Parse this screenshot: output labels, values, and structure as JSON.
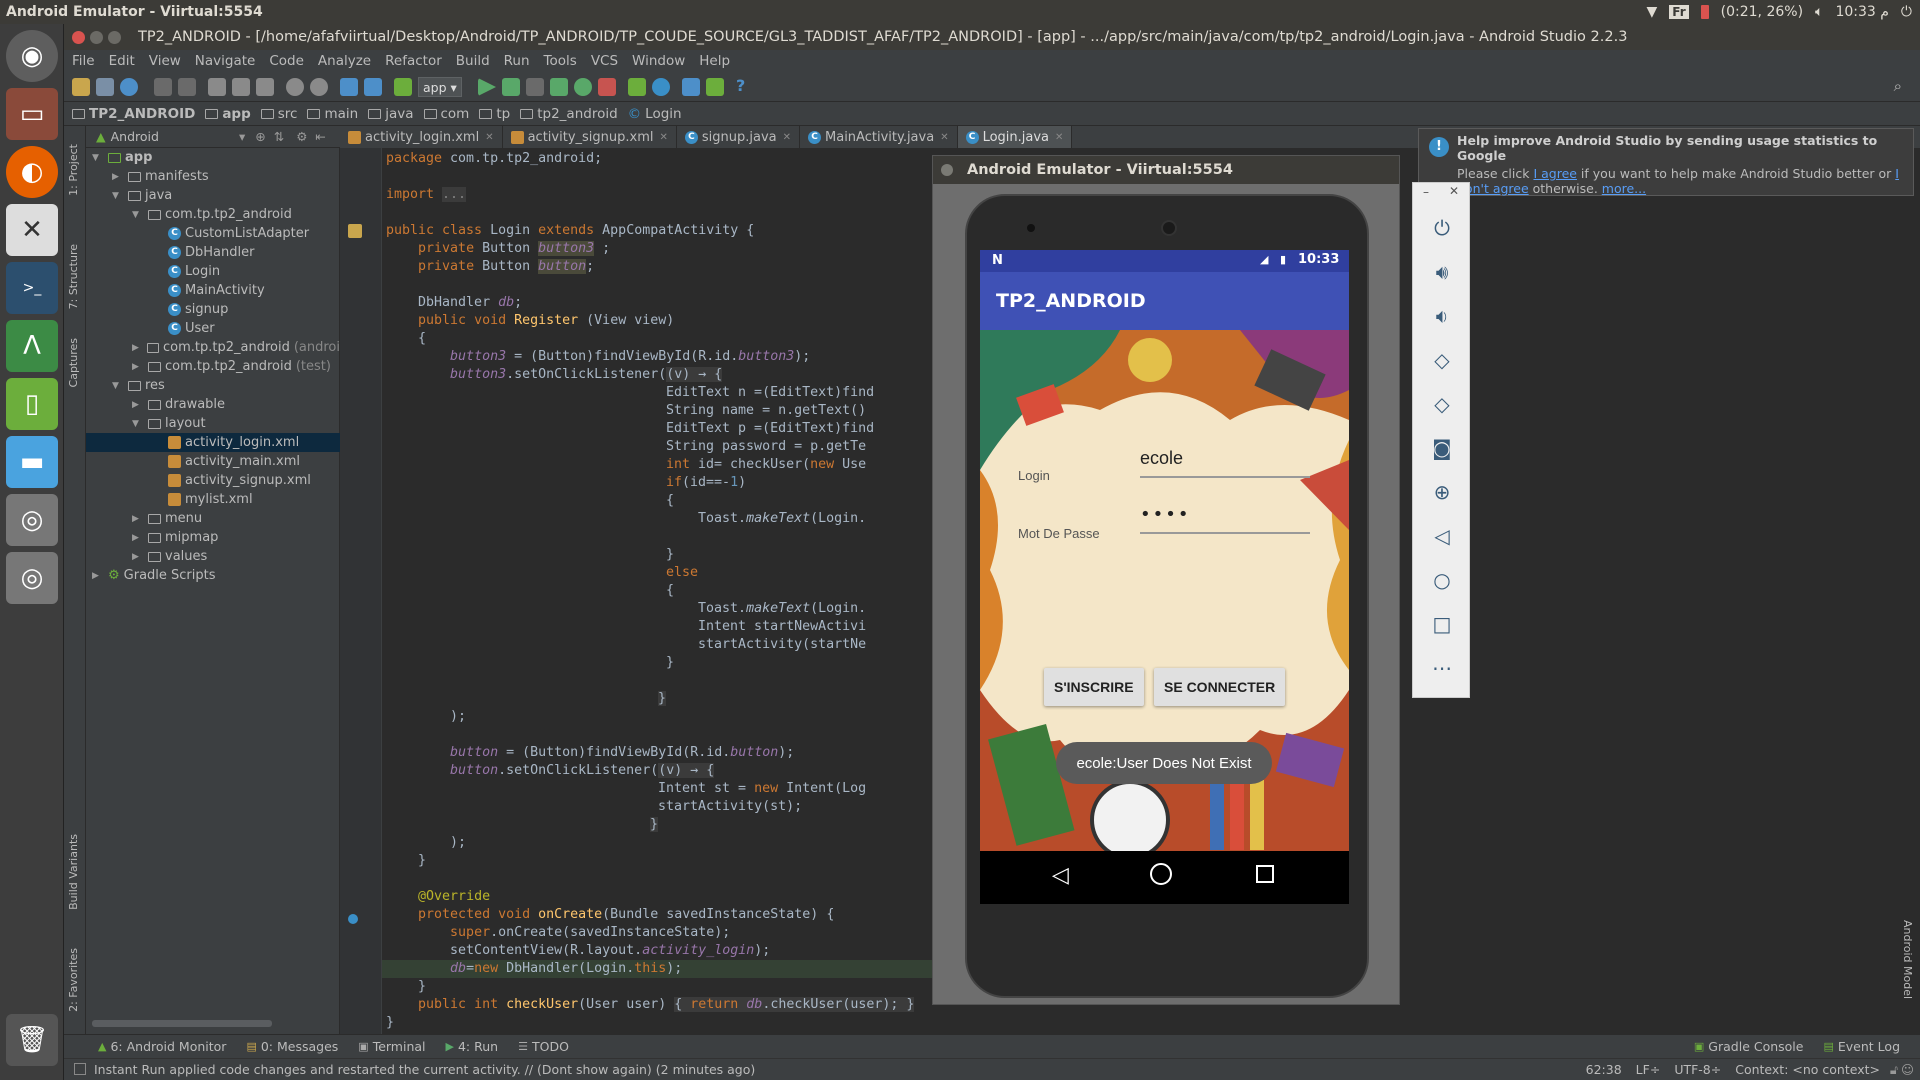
{
  "ubuntu": {
    "window_title": "Android Emulator - Viirtual:5554",
    "battery": "(0:21, 26%)",
    "clock": "10:33 م",
    "lang": "Fr"
  },
  "studio": {
    "title": "TP2_ANDROID - [/home/afafviirtual/Desktop/Android/TP_ANDROID/TP_COUDE_SOURCE/GL3_TADDIST_AFAF/TP2_ANDROID] - [app] - .../app/src/main/java/com/tp/tp2_android/Login.java - Android Studio 2.2.3",
    "menu": [
      "File",
      "Edit",
      "View",
      "Navigate",
      "Code",
      "Analyze",
      "Refactor",
      "Build",
      "Run",
      "Tools",
      "VCS",
      "Window",
      "Help"
    ],
    "run_config": "app",
    "breadcrumbs": [
      "TP2_ANDROID",
      "app",
      "src",
      "main",
      "java",
      "com",
      "tp",
      "tp2_android",
      "Login"
    ],
    "left_tabs": [
      "1: Project",
      "7: Structure",
      "Captures",
      "Build Variants",
      "2: Favorites"
    ],
    "project_view": "Android",
    "tree": [
      {
        "label": "app",
        "depth": 0,
        "type": "module",
        "open": true
      },
      {
        "label": "manifests",
        "depth": 1,
        "type": "folder",
        "open": false
      },
      {
        "label": "java",
        "depth": 1,
        "type": "folder",
        "open": true
      },
      {
        "label": "com.tp.tp2_android",
        "depth": 2,
        "type": "folder",
        "open": true
      },
      {
        "label": "CustomListAdapter",
        "depth": 3,
        "type": "class"
      },
      {
        "label": "DbHandler",
        "depth": 3,
        "type": "class"
      },
      {
        "label": "Login",
        "depth": 3,
        "type": "class"
      },
      {
        "label": "MainActivity",
        "depth": 3,
        "type": "class"
      },
      {
        "label": "signup",
        "depth": 3,
        "type": "class"
      },
      {
        "label": "User",
        "depth": 3,
        "type": "class"
      },
      {
        "label": "com.tp.tp2_android",
        "suffix": "(androi",
        "depth": 2,
        "type": "folder",
        "open": false
      },
      {
        "label": "com.tp.tp2_android",
        "suffix": "(test)",
        "depth": 2,
        "type": "folder",
        "open": false
      },
      {
        "label": "res",
        "depth": 1,
        "type": "folder",
        "open": true
      },
      {
        "label": "drawable",
        "depth": 2,
        "type": "folder",
        "open": false
      },
      {
        "label": "layout",
        "depth": 2,
        "type": "folder",
        "open": true
      },
      {
        "label": "activity_login.xml",
        "depth": 3,
        "type": "xml",
        "selected": true
      },
      {
        "label": "activity_main.xml",
        "depth": 3,
        "type": "xml"
      },
      {
        "label": "activity_signup.xml",
        "depth": 3,
        "type": "xml"
      },
      {
        "label": "mylist.xml",
        "depth": 3,
        "type": "xml"
      },
      {
        "label": "menu",
        "depth": 2,
        "type": "folder",
        "open": false
      },
      {
        "label": "mipmap",
        "depth": 2,
        "type": "folder",
        "open": false
      },
      {
        "label": "values",
        "depth": 2,
        "type": "folder",
        "open": false
      },
      {
        "label": "Gradle Scripts",
        "depth": 0,
        "type": "gradle",
        "open": false
      }
    ],
    "tabs": [
      {
        "label": "activity_login.xml",
        "active": false
      },
      {
        "label": "activity_signup.xml",
        "active": false
      },
      {
        "label": "signup.java",
        "active": false
      },
      {
        "label": "MainActivity.java",
        "active": false
      },
      {
        "label": "Login.java",
        "active": true
      }
    ],
    "bottom_tabs": [
      "6: Android Monitor",
      "0: Messages",
      "Terminal",
      "4: Run",
      "TODO"
    ],
    "bottom_right_tabs": [
      "Gradle Console",
      "Event Log"
    ],
    "status_message": "Instant Run applied code changes and restarted the current activity. // (Dont show again) (2 minutes ago)",
    "status_right": [
      "62:38",
      "LF÷",
      "UTF-8÷",
      "Context: <no context>"
    ],
    "right_tab": "Android Model"
  },
  "notification": {
    "title": "Help improve Android Studio by sending usage statistics to Google",
    "text_before": "Please click ",
    "agree": "I agree",
    "text_middle": " if you want to help make Android Studio better or ",
    "disagree": "I don't agree",
    "text_after": " otherwise. ",
    "more": "more..."
  },
  "emulator": {
    "title": "Android Emulator - Viirtual:5554",
    "phone_time": "10:33",
    "app_title": "TP2_ANDROID",
    "login_label": "Login",
    "login_value": "ecole",
    "password_label": "Mot De Passe",
    "password_value": "••••",
    "signup_button": "S'INSCRIRE",
    "connect_button": "SE CONNECTER",
    "toast": "ecole:User Does Not Exist"
  }
}
